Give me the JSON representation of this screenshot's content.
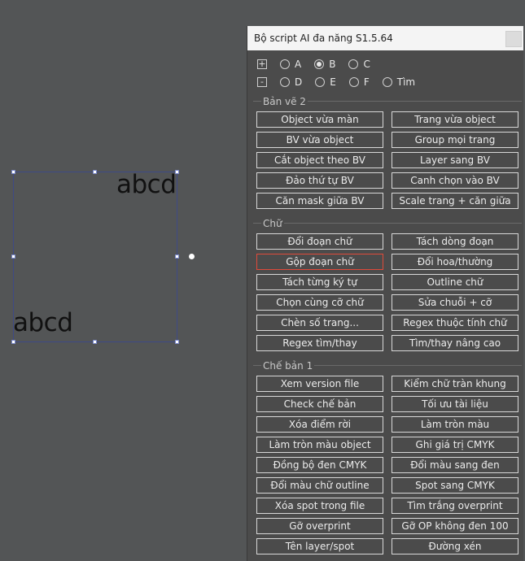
{
  "canvas": {
    "text_top": "abcd",
    "text_bottom": "abcd"
  },
  "panel": {
    "title": "Bộ script AI đa năng S1.5.64",
    "expand_symbol": "+",
    "collapse_symbol": "-",
    "options_row1": [
      {
        "label": "A",
        "selected": false
      },
      {
        "label": "B",
        "selected": true
      },
      {
        "label": "C",
        "selected": false
      }
    ],
    "options_row2": [
      {
        "label": "D",
        "selected": false
      },
      {
        "label": "E",
        "selected": false
      },
      {
        "label": "F",
        "selected": false
      },
      {
        "label": "Tìm",
        "selected": false
      }
    ],
    "sections": [
      {
        "label": "Bản vẽ 2",
        "buttons": [
          "Object vừa màn",
          "Trang vừa object",
          "BV vừa object",
          "Group mọi trang",
          "Cắt object theo BV",
          "Layer sang BV",
          "Đảo thứ tự BV",
          "Canh chọn vào BV",
          "Căn mask giữa BV",
          "Scale trang + căn giữa"
        ]
      },
      {
        "label": "Chữ",
        "buttons": [
          "Đổi đoạn chữ",
          "Tách dòng đoạn",
          "Gộp đoạn chữ",
          "Đổi hoa/thường",
          "Tách từng ký tự",
          "Outline chữ",
          "Chọn cùng cỡ chữ",
          "Sửa chuỗi + cỡ",
          "Chèn số trang...",
          "Regex thuộc tính chữ",
          "Regex tìm/thay",
          "Tìm/thay nâng cao"
        ]
      },
      {
        "label": "Chế bản 1",
        "buttons": [
          "Xem version file",
          "Kiểm chữ tràn khung",
          "Check chế bản",
          "Tối ưu tài liệu",
          "Xóa điểm rời",
          "Làm tròn màu",
          "Làm tròn màu object",
          "Ghi giá trị CMYK",
          "Đồng bộ đen CMYK",
          "Đổi màu sang đen",
          "Đổi màu chữ outline",
          "Spot sang CMYK",
          "Xóa spot trong file",
          "Tìm trắng overprint",
          "Gỡ overprint",
          "Gỡ OP không đen 100",
          "Tên layer/spot",
          "Đường xén"
        ]
      }
    ]
  }
}
